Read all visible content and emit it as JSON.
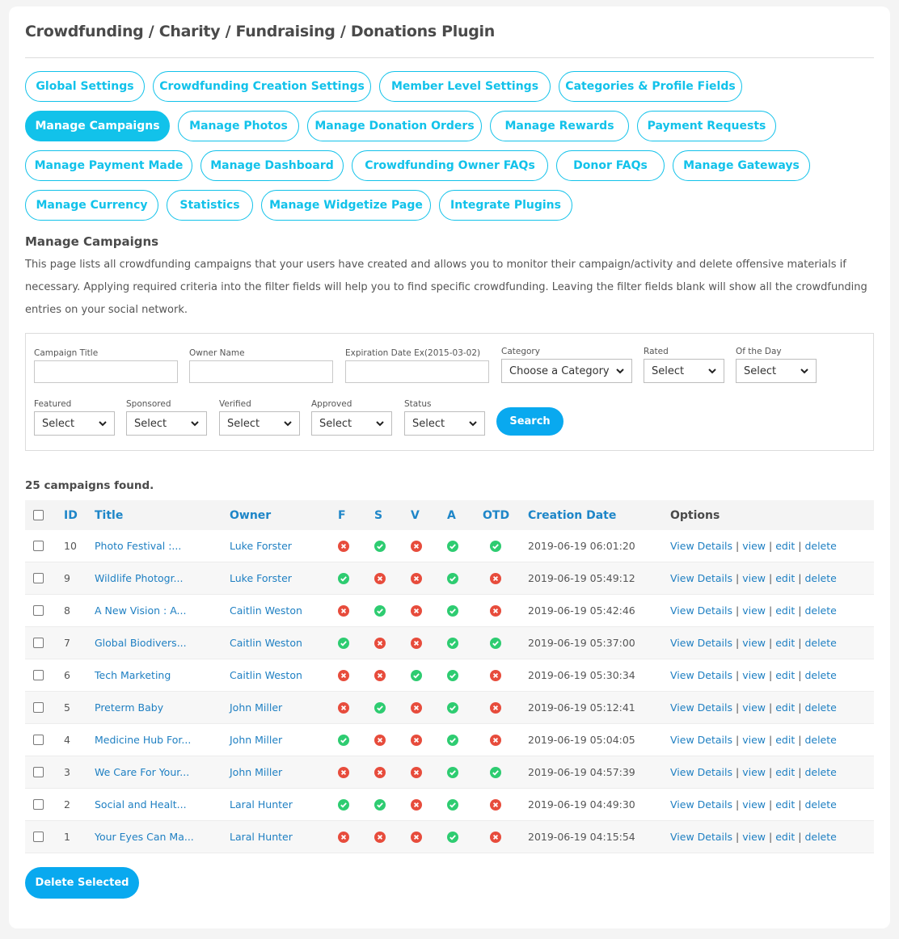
{
  "page_title": "Crowdfunding / Charity / Fundraising / Donations Plugin",
  "nav": {
    "rows": [
      [
        {
          "label": "Global Settings",
          "active": false
        },
        {
          "label": "Crowdfunding Creation Settings",
          "active": false
        },
        {
          "label": "Member Level Settings",
          "active": false
        },
        {
          "label": "Categories & Profile Fields",
          "active": false
        }
      ],
      [
        {
          "label": "Manage Campaigns",
          "active": true
        },
        {
          "label": "Manage Photos",
          "active": false
        },
        {
          "label": "Manage Donation Orders",
          "active": false
        },
        {
          "label": "Manage Rewards",
          "active": false
        },
        {
          "label": "Payment Requests",
          "active": false
        }
      ],
      [
        {
          "label": "Manage Payment Made",
          "active": false
        },
        {
          "label": "Manage Dashboard",
          "active": false
        },
        {
          "label": "Crowdfunding Owner FAQs",
          "active": false
        },
        {
          "label": "Donor FAQs",
          "active": false
        },
        {
          "label": "Manage Gateways",
          "active": false
        }
      ],
      [
        {
          "label": "Manage Currency",
          "active": false
        },
        {
          "label": "Statistics",
          "active": false
        },
        {
          "label": "Manage Widgetize Page",
          "active": false
        },
        {
          "label": "Integrate Plugins",
          "active": false
        }
      ]
    ]
  },
  "section": {
    "heading": "Manage Campaigns",
    "description": "This page lists all crowdfunding campaigns that your users have created and allows you to monitor their campaign/activity and delete offensive materials if necessary. Applying required criteria into the filter fields will help you to find specific crowdfunding. Leaving the filter fields blank will show all the crowdfunding entries on your social network."
  },
  "filters": {
    "campaign_title": {
      "label": "Campaign Title",
      "value": ""
    },
    "owner_name": {
      "label": "Owner Name",
      "value": ""
    },
    "expiration_date": {
      "label": "Expiration Date Ex(2015-03-02)",
      "value": ""
    },
    "category": {
      "label": "Category",
      "value": "Choose a Category"
    },
    "rated": {
      "label": "Rated",
      "value": "Select"
    },
    "of_the_day": {
      "label": "Of the Day",
      "value": "Select"
    },
    "featured": {
      "label": "Featured",
      "value": "Select"
    },
    "sponsored": {
      "label": "Sponsored",
      "value": "Select"
    },
    "verified": {
      "label": "Verified",
      "value": "Select"
    },
    "approved": {
      "label": "Approved",
      "value": "Select"
    },
    "status": {
      "label": "Status",
      "value": "Select"
    },
    "search_label": "Search"
  },
  "results": {
    "count_text": "25 campaigns found.",
    "columns": {
      "id": "ID",
      "title": "Title",
      "owner": "Owner",
      "f": "F",
      "s": "S",
      "v": "V",
      "a": "A",
      "otd": "OTD",
      "date": "Creation Date",
      "options": "Options"
    },
    "option_links": {
      "view_details": "View Details",
      "view": "view",
      "edit": "edit",
      "delete": "delete",
      "separator": "|"
    },
    "rows": [
      {
        "id": "10",
        "title": "Photo Festival :...",
        "owner": "Luke Forster",
        "f": false,
        "s": true,
        "v": false,
        "a": true,
        "otd": true,
        "date": "2019-06-19 06:01:20"
      },
      {
        "id": "9",
        "title": "Wildlife Photogr...",
        "owner": "Luke Forster",
        "f": true,
        "s": false,
        "v": false,
        "a": true,
        "otd": false,
        "date": "2019-06-19 05:49:12"
      },
      {
        "id": "8",
        "title": "A New Vision : A...",
        "owner": "Caitlin Weston",
        "f": false,
        "s": true,
        "v": false,
        "a": true,
        "otd": false,
        "date": "2019-06-19 05:42:46"
      },
      {
        "id": "7",
        "title": "Global Biodivers...",
        "owner": "Caitlin Weston",
        "f": true,
        "s": false,
        "v": false,
        "a": true,
        "otd": true,
        "date": "2019-06-19 05:37:00"
      },
      {
        "id": "6",
        "title": "Tech Marketing",
        "owner": "Caitlin Weston",
        "f": false,
        "s": false,
        "v": true,
        "a": true,
        "otd": false,
        "date": "2019-06-19 05:30:34"
      },
      {
        "id": "5",
        "title": "Preterm Baby",
        "owner": "John Miller",
        "f": false,
        "s": true,
        "v": false,
        "a": true,
        "otd": false,
        "date": "2019-06-19 05:12:41"
      },
      {
        "id": "4",
        "title": "Medicine Hub For...",
        "owner": "John Miller",
        "f": true,
        "s": false,
        "v": false,
        "a": true,
        "otd": false,
        "date": "2019-06-19 05:04:05"
      },
      {
        "id": "3",
        "title": "We Care For Your...",
        "owner": "John Miller",
        "f": false,
        "s": false,
        "v": false,
        "a": true,
        "otd": true,
        "date": "2019-06-19 04:57:39"
      },
      {
        "id": "2",
        "title": "Social and Healt...",
        "owner": "Laral Hunter",
        "f": true,
        "s": true,
        "v": false,
        "a": true,
        "otd": false,
        "date": "2019-06-19 04:49:30"
      },
      {
        "id": "1",
        "title": "Your Eyes Can Ma...",
        "owner": "Laral Hunter",
        "f": false,
        "s": false,
        "v": false,
        "a": true,
        "otd": false,
        "date": "2019-06-19 04:15:54"
      }
    ]
  },
  "delete_selected_label": "Delete Selected",
  "colors": {
    "accent": "#12c2ea",
    "button": "#09a9ef",
    "link": "#1e7fc2",
    "yes": "#2ecc71",
    "no": "#e74c3c"
  }
}
